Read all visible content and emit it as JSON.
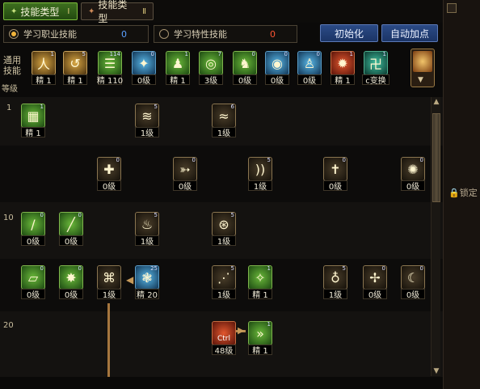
{
  "tabs": [
    {
      "label": "技能类型",
      "num": "Ⅰ",
      "active": true
    },
    {
      "label": "技能类型",
      "num": "Ⅱ",
      "active": false
    }
  ],
  "modes": {
    "job": {
      "label": "学习职业技能",
      "count": "0"
    },
    "trait": {
      "label": "学习特性技能",
      "count": "0"
    }
  },
  "buttons": {
    "init": "初始化",
    "auto": "自动加点"
  },
  "labels": {
    "common_skills": "通用\n技能",
    "level": "等级",
    "lock": "锁定"
  },
  "row_levels": [
    "1",
    "10",
    "20"
  ],
  "common_skills": [
    {
      "cap": "精 1",
      "badge": "1",
      "color": "cgold",
      "glyph": "人"
    },
    {
      "cap": "精 1",
      "badge": "5",
      "color": "cgold",
      "glyph": "↺"
    },
    {
      "cap": "精 110",
      "badge": "114",
      "color": "cgreen",
      "glyph": "☰"
    },
    {
      "cap": "0级",
      "badge": "0",
      "color": "cblue",
      "glyph": "✦"
    },
    {
      "cap": "精 1",
      "badge": "1",
      "color": "cgreen",
      "glyph": "♟"
    },
    {
      "cap": "3级",
      "badge": "7",
      "color": "cgreen",
      "glyph": "◎"
    },
    {
      "cap": "0级",
      "badge": "0",
      "color": "cgreen",
      "glyph": "♞"
    },
    {
      "cap": "0级",
      "badge": "0",
      "color": "cblue",
      "glyph": "◉"
    },
    {
      "cap": "0级",
      "badge": "0",
      "color": "cblue",
      "glyph": "♙"
    },
    {
      "cap": "精 1",
      "badge": "1",
      "color": "cred",
      "glyph": "✹"
    },
    {
      "cap": "c变换",
      "badge": "1",
      "color": "cteal",
      "glyph": "卍"
    }
  ],
  "tree_skills": [
    {
      "cap": "精 1",
      "badge": "1",
      "color": "cgreen",
      "glyph": "▦"
    },
    {
      "cap": "1级",
      "badge": "5",
      "color": "cdark",
      "glyph": "≋"
    },
    {
      "cap": "1级",
      "badge": "6",
      "color": "cdark",
      "glyph": "≈"
    },
    {
      "cap": "0级",
      "badge": "0",
      "color": "cdark",
      "glyph": "✚"
    },
    {
      "cap": "0级",
      "badge": "0",
      "color": "cdark",
      "glyph": "➳"
    },
    {
      "cap": "1级",
      "badge": "5",
      "color": "cdark",
      "glyph": "))"
    },
    {
      "cap": "0级",
      "badge": "0",
      "color": "cdark",
      "glyph": "✝"
    },
    {
      "cap": "0级",
      "badge": "0",
      "color": "cdark",
      "glyph": "✺"
    },
    {
      "cap": "0级",
      "badge": "0",
      "color": "cgreen",
      "glyph": "/"
    },
    {
      "cap": "0级",
      "badge": "0",
      "color": "cgreen",
      "glyph": "╱"
    },
    {
      "cap": "1级",
      "badge": "5",
      "color": "cdark",
      "glyph": "♨"
    },
    {
      "cap": "1级",
      "badge": "5",
      "color": "cdark",
      "glyph": "⊛"
    },
    {
      "cap": "0级",
      "badge": "0",
      "color": "cgreen",
      "glyph": "▱"
    },
    {
      "cap": "0级",
      "badge": "0",
      "color": "cgreen",
      "glyph": "✸"
    },
    {
      "cap": "1级",
      "badge": "",
      "color": "cdark",
      "glyph": "⌘"
    },
    {
      "cap": "精 20",
      "badge": "25",
      "color": "cblue",
      "glyph": "❃"
    },
    {
      "cap": "1级",
      "badge": "5",
      "color": "cdark",
      "glyph": "⋰"
    },
    {
      "cap": "精 1",
      "badge": "1",
      "color": "cgreen",
      "glyph": "✧"
    },
    {
      "cap": "1级",
      "badge": "5",
      "color": "cdark",
      "glyph": "♁"
    },
    {
      "cap": "0级",
      "badge": "0",
      "color": "cdark",
      "glyph": "✢"
    },
    {
      "cap": "0级",
      "badge": "0",
      "color": "cdark",
      "glyph": "☾"
    },
    {
      "cap": "48级",
      "badge": "",
      "color": "cred",
      "glyph": "Ctrl"
    },
    {
      "cap": "精 1",
      "badge": "1",
      "color": "cgreen",
      "glyph": "»"
    }
  ],
  "colors": {
    "accent_green": "#7bbd3b",
    "button_blue": "#2b4b86",
    "count_blue": "#5aa0ff",
    "count_red": "#ff5533"
  }
}
